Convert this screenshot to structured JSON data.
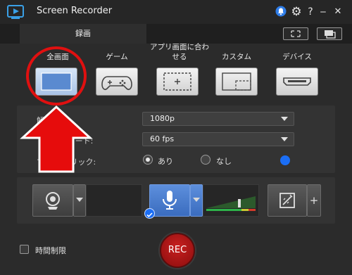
{
  "window": {
    "title": "Screen Recorder",
    "title_icons": [
      "notification-icon",
      "gear-icon",
      "help-icon",
      "minimize-icon",
      "close-icon"
    ]
  },
  "tabs": [
    {
      "label": "録画",
      "selected": true
    }
  ],
  "toolbar_right": [
    "fullscreen-view-icon",
    "window-view-icon"
  ],
  "capture_modes": [
    {
      "label": "全画面",
      "icon": "fullscreen-icon",
      "selected": true
    },
    {
      "label": "ゲーム",
      "icon": "gamepad-icon",
      "selected": false
    },
    {
      "label": "アプリ画面に合わせる",
      "icon": "app-window-icon",
      "selected": false
    },
    {
      "label": "カスタム",
      "icon": "custom-region-icon",
      "selected": false
    },
    {
      "label": "デバイス",
      "icon": "hdmi-device-icon",
      "selected": false
    }
  ],
  "settings": {
    "resolution": {
      "label": "解像度:",
      "value": "1080p"
    },
    "framerate": {
      "label": "フレームレート:",
      "value": "60 fps"
    },
    "mouse_click": {
      "label": "マウス クリック:",
      "options": [
        "あり",
        "なし"
      ],
      "selected": "あり"
    }
  },
  "devices": {
    "webcam_icon": "webcam-icon",
    "mic_icon": "microphone-icon",
    "effects_icon": "effects-icon",
    "add_symbol": "+"
  },
  "footer": {
    "time_limit_label": "時間制限",
    "time_limit_checked": false,
    "rec_label": "REC"
  },
  "colors": {
    "accent_blue": "#1b6ef5",
    "rec_red": "#b81616",
    "annotation_red": "#e01010"
  }
}
